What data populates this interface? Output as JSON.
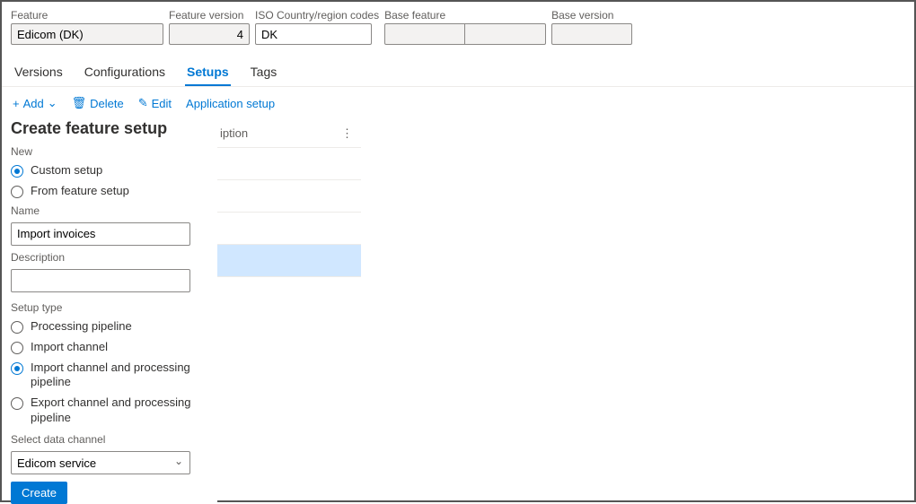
{
  "header": {
    "feature_label": "Feature",
    "feature_value": "Edicom (DK)",
    "version_label": "Feature version",
    "version_value": "4",
    "iso_label": "ISO Country/region codes",
    "iso_value": "DK",
    "base_feature_label": "Base feature",
    "base_feature_value": "",
    "base_version_label": "Base version",
    "base_version_value": ""
  },
  "tabs": {
    "versions": "Versions",
    "configurations": "Configurations",
    "setups": "Setups",
    "tags": "Tags"
  },
  "toolbar": {
    "add": "Add",
    "delete": "Delete",
    "edit": "Edit",
    "app_setup": "Application setup"
  },
  "table": {
    "col_desc_partial": "iption"
  },
  "panel": {
    "title": "Create feature setup",
    "new_label": "New",
    "opt_custom": "Custom setup",
    "opt_from": "From feature setup",
    "name_label": "Name",
    "name_value": "Import invoices",
    "desc_label": "Description",
    "desc_value": "",
    "type_label": "Setup type",
    "opt_processing": "Processing pipeline",
    "opt_import": "Import channel",
    "opt_import_proc": "Import channel and processing pipeline",
    "opt_export_proc": "Export channel and processing pipeline",
    "select_channel_label": "Select data channel",
    "select_channel_value": "Edicom service",
    "create_btn": "Create"
  }
}
